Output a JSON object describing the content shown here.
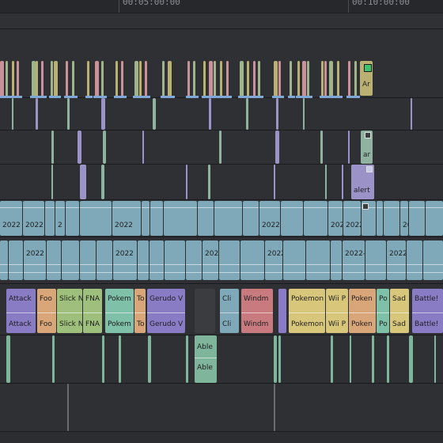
{
  "ruler": {
    "labels": [
      "00:05:00:00",
      "00:10:00:00"
    ]
  },
  "tracks": [
    {
      "name": "marker-track",
      "kind": "markers"
    },
    {
      "name": "video-track-alerts-a",
      "kind": "alerts"
    },
    {
      "name": "video-track-alerts-b",
      "kind": "alerts"
    },
    {
      "name": "video-track-alerts-c",
      "kind": "alerts"
    },
    {
      "name": "video-track-dated-a",
      "kind": "dated"
    },
    {
      "name": "video-track-dated-b",
      "kind": "dated"
    },
    {
      "name": "video-track-games",
      "kind": "games"
    },
    {
      "name": "audio-track-a",
      "kind": "audio"
    },
    {
      "name": "audio-track-b",
      "kind": "audio"
    }
  ],
  "colors": {
    "marker_pink": "#c9929a",
    "marker_green": "#9fb48a",
    "marker_olive": "#b9b072",
    "alert_green": "#8fb3a0",
    "alert_purple": "#9b93c8",
    "dated_blue": "#7fa9b8",
    "game_purple": "#8a7cc4",
    "game_orange": "#d9a67a",
    "game_green": "#9fc07c",
    "game_teal": "#7fc0a8",
    "game_yellow": "#d8c77a",
    "game_red": "#c97a7e",
    "audio_green": "#7fb59b"
  },
  "clips": {
    "markers_text": [
      "Ar"
    ],
    "alerts_text": [
      "ar",
      "alert"
    ],
    "dated_text": [
      "2022",
      "2022",
      "2",
      "2022",
      "2022",
      "2022",
      "2022-",
      "2022"
    ],
    "dated2_text": [
      "2022",
      "2022",
      "2022",
      "2022-",
      "2022-12",
      "2022-"
    ],
    "games_text": [
      "Attack",
      "Foo",
      "Slick N",
      "FNA",
      "Pokem",
      "To",
      "Gerudo V",
      "Cli",
      "Windm",
      "Pokemon",
      "Wii P",
      "Poken",
      "Po",
      "Sad",
      "Battle!"
    ],
    "audio_text": [
      "Able",
      "Able"
    ]
  }
}
